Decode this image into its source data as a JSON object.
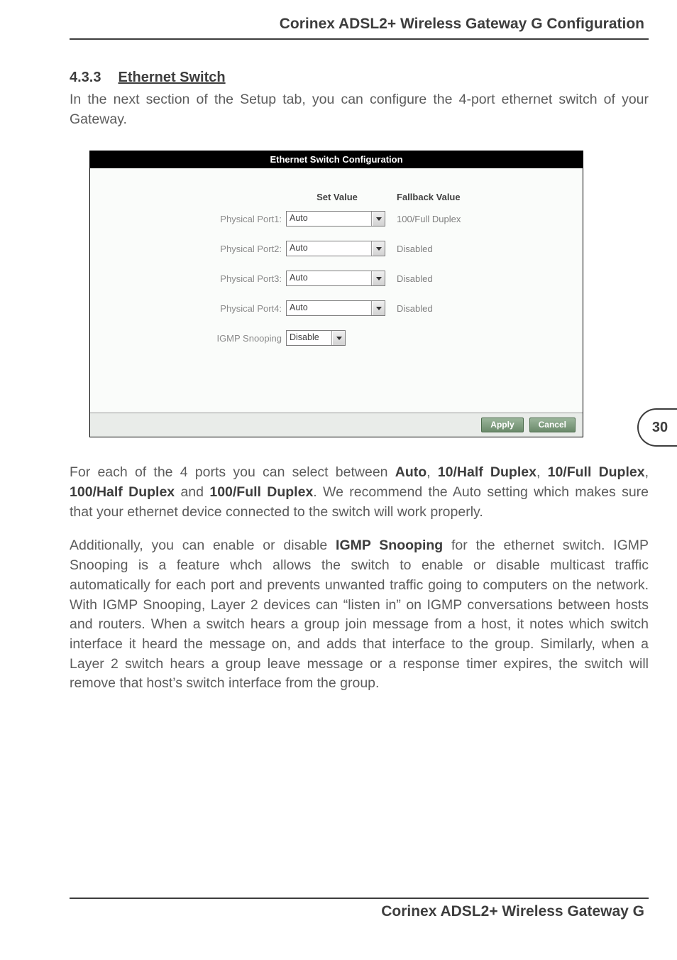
{
  "header": {
    "title": "Corinex ADSL2+ Wireless Gateway G Configuration"
  },
  "section": {
    "number": "4.3.3",
    "title": "Ethernet Switch"
  },
  "intro": "In the next section of the Setup tab, you can configure the 4-port ethernet switch of your Gateway.",
  "ui": {
    "title": "Ethernet Switch Configuration",
    "col_set": "Set Value",
    "col_fb": "Fallback Value",
    "rows": [
      {
        "label": "Physical Port1:",
        "value": "Auto",
        "fallback": "100/Full Duplex"
      },
      {
        "label": "Physical Port2:",
        "value": "Auto",
        "fallback": "Disabled"
      },
      {
        "label": "Physical Port3:",
        "value": "Auto",
        "fallback": "Disabled"
      },
      {
        "label": "Physical Port4:",
        "value": "Auto",
        "fallback": "Disabled"
      }
    ],
    "igmp": {
      "label": "IGMP Snooping",
      "value": "Disable"
    },
    "apply": "Apply",
    "cancel": "Cancel"
  },
  "paras": {
    "p2_a": "For each of the 4 ports you can select between ",
    "p2_b1": "Auto",
    "p2_c1": ", ",
    "p2_b2": "10/Half Duplex",
    "p2_c2": ", ",
    "p2_b3": "10/Full Duplex",
    "p2_c3": ", ",
    "p2_b4": "100/Half Duplex",
    "p2_c4": " and ",
    "p2_b5": "100/Full Duplex",
    "p2_d": ". We recommend the Auto setting which makes sure that your ethernet device connected to the switch will work properly.",
    "p3_a": "Additionally, you can enable or disable ",
    "p3_b": "IGMP Snooping",
    "p3_c": " for the ethernet switch. IGMP Snooping is a feature whch allows the switch to enable or disable multicast traffic automatically for each port and prevents unwanted traffic going to computers on the network. With IGMP Snooping, Layer 2 devices can “listen in” on IGMP conversations between hosts and routers. When a switch hears a group join message from a host, it notes which switch interface it heard the message on, and adds that interface to the group. Similarly, when a Layer 2 switch hears a group leave message or a response timer expires, the switch will remove that host’s switch interface from the group."
  },
  "page_number": "30",
  "footer": {
    "title": "Corinex ADSL2+ Wireless Gateway G"
  }
}
